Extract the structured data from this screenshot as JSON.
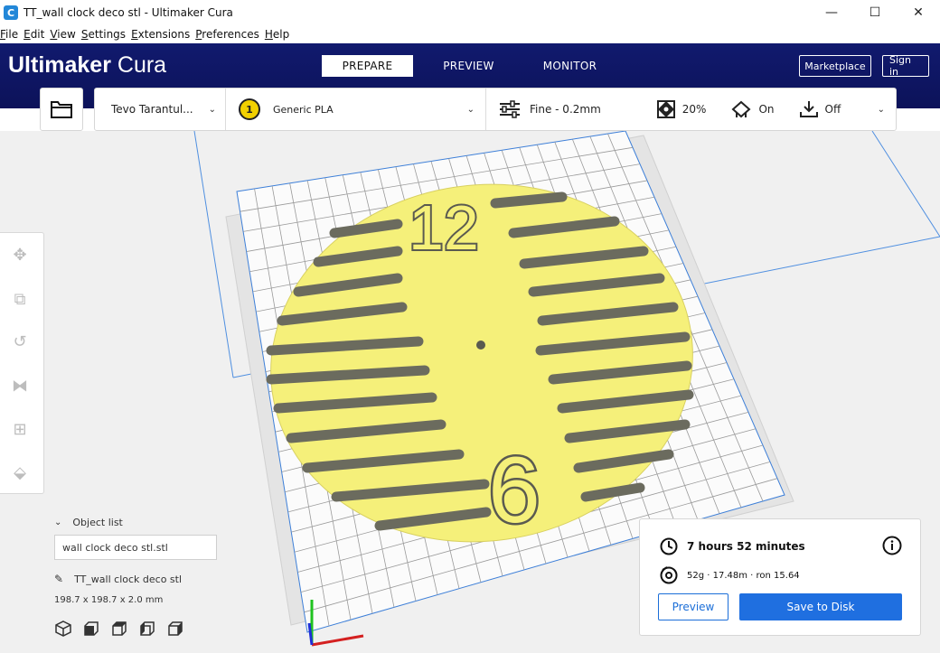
{
  "window": {
    "title": "TT_wall clock deco stl - Ultimaker Cura",
    "app_icon_letter": "C",
    "controls": {
      "minimize": "—",
      "maximize": "☐",
      "close": "✕"
    }
  },
  "menu": [
    {
      "u": "F",
      "rest": "ile"
    },
    {
      "u": "E",
      "rest": "dit"
    },
    {
      "u": "V",
      "rest": "iew"
    },
    {
      "u": "S",
      "rest": "ettings"
    },
    {
      "u": "E",
      "rest": "xtensions"
    },
    {
      "u": "P",
      "rest": "references"
    },
    {
      "u": "H",
      "rest": "elp"
    }
  ],
  "header": {
    "brand_bold": "Ultimaker",
    "brand_light": " Cura",
    "tabs": [
      "PREPARE",
      "PREVIEW",
      "MONITOR"
    ],
    "active_tab": "PREPARE",
    "marketplace": "Marketplace",
    "sign_in": "Sign in"
  },
  "toolbar": {
    "printer": "Tevo Tarantul...",
    "extruder_number": "1",
    "material": "Generic PLA",
    "profile": "Fine - 0.2mm",
    "infill": "20%",
    "support": "On",
    "adhesion": "Off"
  },
  "clock_model": {
    "numeral_top": "12",
    "numeral_bottom": "6",
    "color": "#f5f07a"
  },
  "object_list": {
    "header": "Object list",
    "item": "wall clock deco stl.stl",
    "name": "TT_wall clock deco stl",
    "dimensions": "198.7 x 198.7 x 2.0 mm"
  },
  "print": {
    "time": "7 hours 52 minutes",
    "material_usage": "52g · 17.48m · ron 15.64",
    "preview": "Preview",
    "save": "Save to Disk"
  },
  "colors": {
    "header_bg": "#10166a",
    "accent": "#1f6fe0",
    "model": "#f5f07a"
  }
}
